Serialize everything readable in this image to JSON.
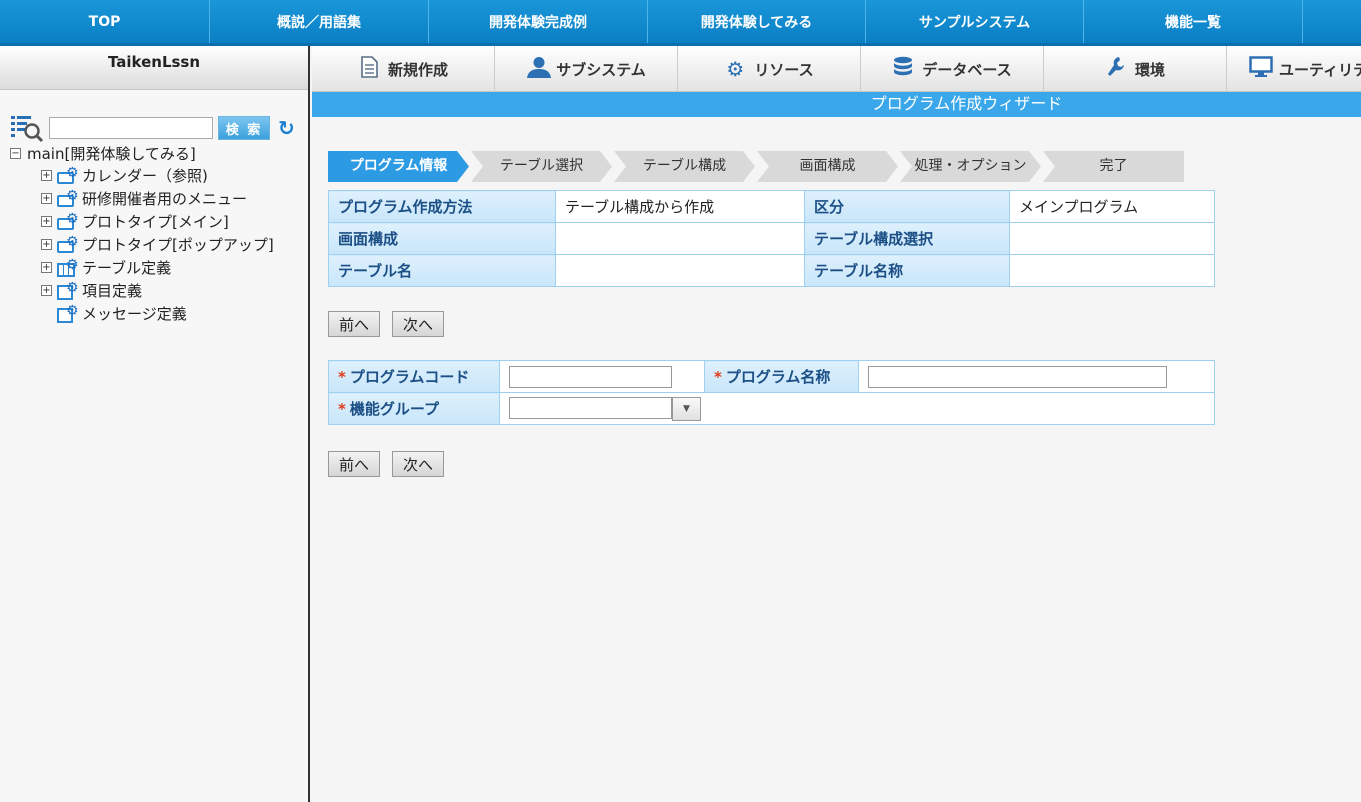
{
  "topnav": {
    "items": [
      "TOP",
      "概説／用語集",
      "開発体験完成例",
      "開発体験してみる",
      "サンプルシステム",
      "機能一覧"
    ]
  },
  "sidebar": {
    "title": "TaikenLssn",
    "search": {
      "value": "",
      "button_label": "検 索"
    },
    "tree": {
      "root_label": "main[開発体験してみる]",
      "items": [
        {
          "label": "カレンダー（参照)",
          "icon": "folder-gear-icon"
        },
        {
          "label": "研修開催者用のメニュー",
          "icon": "folder-gear-icon"
        },
        {
          "label": "プロトタイプ[メイン]",
          "icon": "folder-gear-icon"
        },
        {
          "label": "プロトタイプ[ポップアップ]",
          "icon": "folder-gear-icon"
        },
        {
          "label": "テーブル定義",
          "icon": "table-gear-icon"
        },
        {
          "label": "項目定義",
          "icon": "item-gear-icon"
        },
        {
          "label": "メッセージ定義",
          "icon": "message-gear-icon"
        }
      ]
    }
  },
  "toolbar": {
    "items": [
      {
        "label": "新規作成",
        "icon": "document-icon"
      },
      {
        "label": "サブシステム",
        "icon": "user-icon"
      },
      {
        "label": "リソース",
        "icon": "gear-icon"
      },
      {
        "label": "データベース",
        "icon": "database-icon"
      },
      {
        "label": "環境",
        "icon": "wrench-icon"
      },
      {
        "label": "ユーティリティ",
        "icon": "monitor-icon"
      }
    ]
  },
  "wizard": {
    "title": "プログラム作成ウィザード",
    "steps": [
      "プログラム情報",
      "テーブル選択",
      "テーブル構成",
      "画面構成",
      "処理・オプション",
      "完了"
    ],
    "active_step": 0,
    "summary": {
      "method_label": "プログラム作成方法",
      "method_value": "テーブル構成から作成",
      "kubun_label": "区分",
      "kubun_value": "メインプログラム",
      "screen_label": "画面構成",
      "screen_value": "",
      "table_config_label": "テーブル構成選択",
      "table_config_value": "",
      "table_name_label": "テーブル名",
      "table_name_value": "",
      "table_title_label": "テーブル名称",
      "table_title_value": ""
    },
    "prev_label": "前へ",
    "next_label": "次へ",
    "form": {
      "required_mark": "*",
      "code_label": "プログラムコード",
      "code_value": "",
      "name_label": "プログラム名称",
      "name_value": "",
      "group_label": "機能グループ",
      "group_value": ""
    }
  },
  "colors": {
    "accent": "#2d9be3",
    "nav": "#0a7fc4",
    "required": "#e23b1d"
  }
}
